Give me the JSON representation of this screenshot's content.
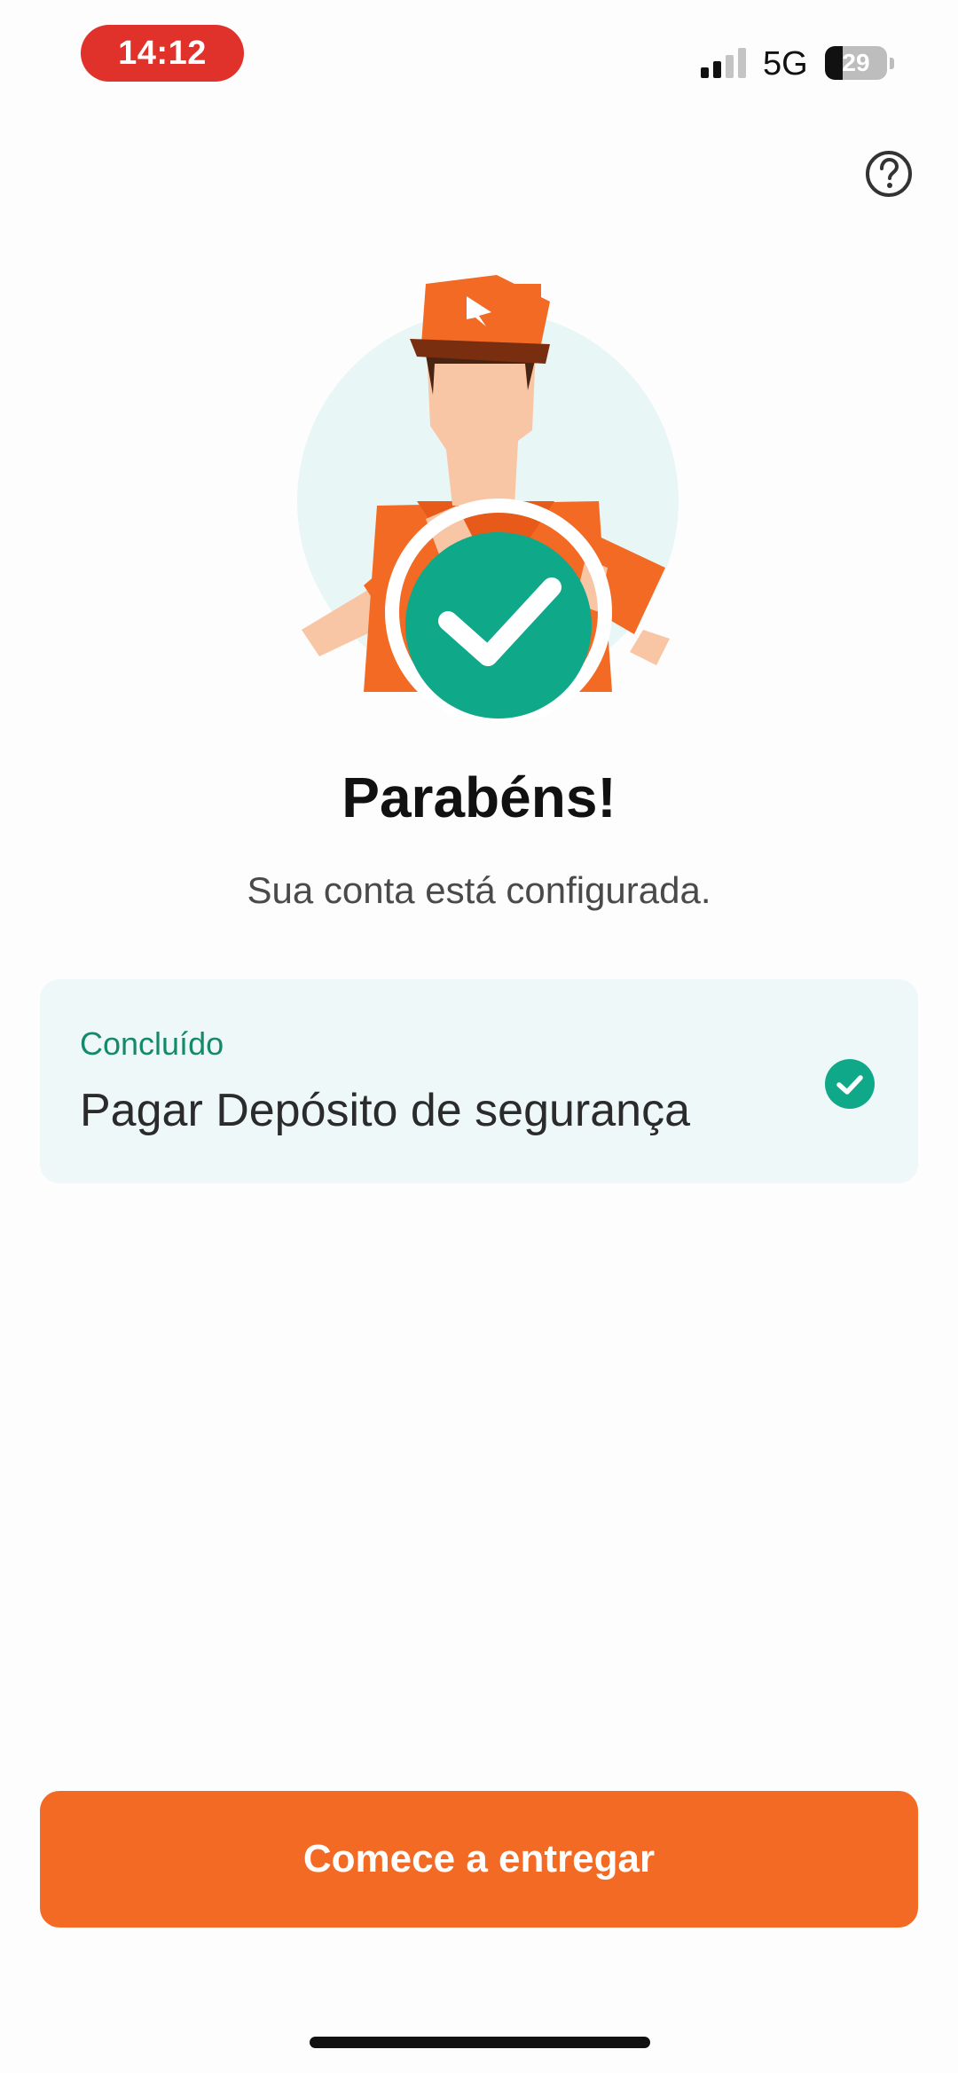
{
  "status_bar": {
    "time": "14:12",
    "network": "5G",
    "battery": "29",
    "battery_level": 0.29,
    "signal_bars_active": 2,
    "signal_bars_total": 4
  },
  "header": {
    "help_icon": "question-circle-icon"
  },
  "illustration": {
    "icon": "courier-check-illustration",
    "colors": {
      "uniform": "#f26a24",
      "badge": "#0fa889",
      "background": "#e8f6f6"
    }
  },
  "main": {
    "title": "Parabéns!",
    "subtitle": "Sua conta está configurada."
  },
  "task": {
    "status": "Concluído",
    "name": "Pagar Depósito de segurança",
    "icon": "check-circle-icon",
    "status_color": "#148a6a"
  },
  "footer": {
    "primary_button": "Comece a entregar",
    "accent": "#f26a24"
  }
}
